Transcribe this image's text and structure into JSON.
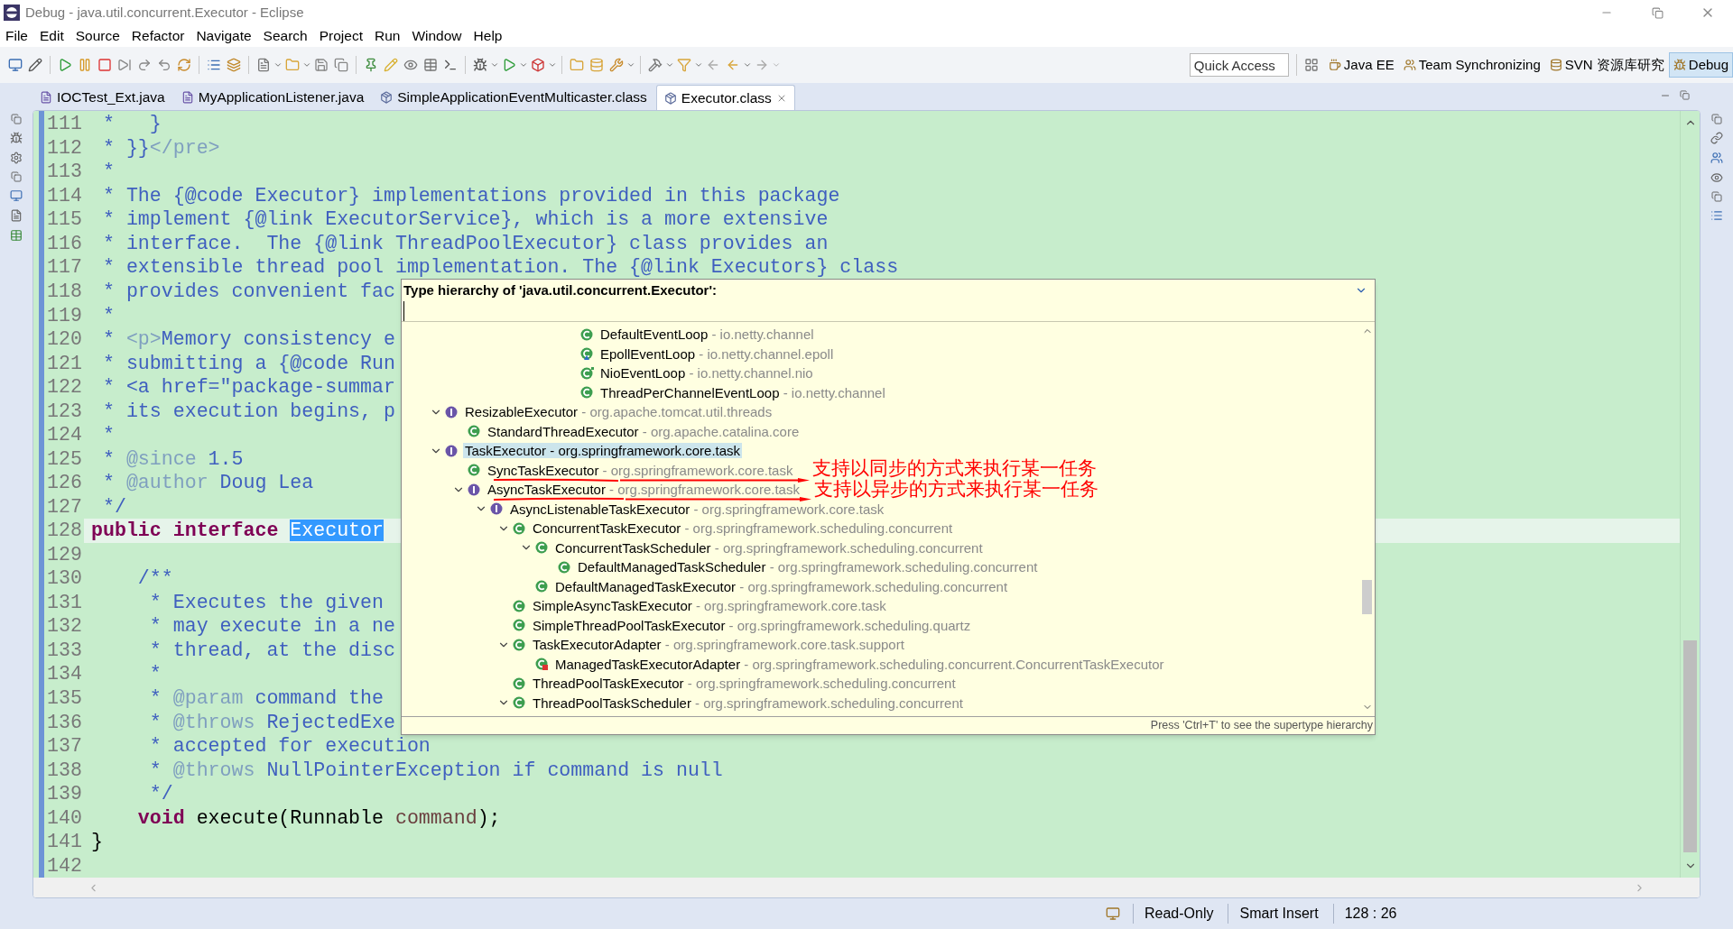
{
  "window": {
    "title": "Debug - java.util.concurrent.Executor - Eclipse"
  },
  "menu": [
    "File",
    "Edit",
    "Source",
    "Refactor",
    "Navigate",
    "Search",
    "Project",
    "Run",
    "Window",
    "Help"
  ],
  "quick_access": {
    "placeholder": "Quick Access"
  },
  "perspectives": [
    {
      "label": "Java EE",
      "selected": false
    },
    {
      "label": "Team Synchronizing",
      "selected": false
    },
    {
      "label": "SVN 资源库研究",
      "selected": false
    },
    {
      "label": "Debug",
      "selected": true
    }
  ],
  "editor_tabs": [
    {
      "label": "IOCTest_Ext.java",
      "kind": "java",
      "selected": false
    },
    {
      "label": "MyApplicationListener.java",
      "kind": "java",
      "selected": false
    },
    {
      "label": "SimpleApplicationEventMulticaster.class",
      "kind": "class",
      "selected": false
    },
    {
      "label": "Executor.class",
      "kind": "class",
      "selected": true
    }
  ],
  "code_lines": [
    {
      "number": "111",
      "current": false,
      "segments": [
        {
          "kind": "comment",
          "text": " *   }"
        }
      ]
    },
    {
      "number": "112",
      "current": false,
      "segments": [
        {
          "kind": "comment",
          "text": " * }}"
        },
        {
          "kind": "doc-tag",
          "text": "</pre>"
        }
      ]
    },
    {
      "number": "113",
      "current": false,
      "segments": [
        {
          "kind": "comment",
          "text": " *"
        }
      ]
    },
    {
      "number": "114",
      "current": false,
      "segments": [
        {
          "kind": "comment",
          "text": " * The {@code Executor} implementations provided in this package"
        }
      ]
    },
    {
      "number": "115",
      "current": false,
      "segments": [
        {
          "kind": "comment",
          "text": " * implement {@link ExecutorService}, which is a more extensive"
        }
      ]
    },
    {
      "number": "116",
      "current": false,
      "segments": [
        {
          "kind": "comment",
          "text": " * interface.  The {@link ThreadPoolExecutor} class provides an"
        }
      ]
    },
    {
      "number": "117",
      "current": false,
      "segments": [
        {
          "kind": "comment",
          "text": " * extensible thread pool implementation. The {@link Executors} class"
        }
      ]
    },
    {
      "number": "118",
      "current": false,
      "segments": [
        {
          "kind": "comment",
          "text": " * provides convenient fac"
        }
      ]
    },
    {
      "number": "119",
      "current": false,
      "segments": [
        {
          "kind": "comment",
          "text": " *"
        }
      ]
    },
    {
      "number": "120",
      "current": false,
      "segments": [
        {
          "kind": "comment",
          "text": " * "
        },
        {
          "kind": "doc-tag",
          "text": "<p>"
        },
        {
          "kind": "comment",
          "text": "Memory consistency e"
        }
      ]
    },
    {
      "number": "121",
      "current": false,
      "segments": [
        {
          "kind": "comment",
          "text": " * submitting a {@code Run"
        }
      ]
    },
    {
      "number": "122",
      "current": false,
      "segments": [
        {
          "kind": "comment",
          "text": " * <a href=\"package-summar"
        }
      ]
    },
    {
      "number": "123",
      "current": false,
      "segments": [
        {
          "kind": "comment",
          "text": " * its execution begins, p"
        }
      ]
    },
    {
      "number": "124",
      "current": false,
      "segments": [
        {
          "kind": "comment",
          "text": " *"
        }
      ]
    },
    {
      "number": "125",
      "current": false,
      "segments": [
        {
          "kind": "comment",
          "text": " * "
        },
        {
          "kind": "doc-tag",
          "text": "@since"
        },
        {
          "kind": "comment",
          "text": " 1.5"
        }
      ]
    },
    {
      "number": "126",
      "current": false,
      "segments": [
        {
          "kind": "comment",
          "text": " * "
        },
        {
          "kind": "doc-tag",
          "text": "@author"
        },
        {
          "kind": "comment",
          "text": " Doug Lea"
        }
      ]
    },
    {
      "number": "127",
      "current": false,
      "segments": [
        {
          "kind": "comment",
          "text": " */"
        }
      ]
    },
    {
      "number": "128",
      "current": true,
      "segments": [
        {
          "kind": "keyword",
          "text": "public interface "
        },
        {
          "kind": "selection",
          "text": "Executor"
        }
      ]
    },
    {
      "number": "129",
      "current": false
    },
    {
      "number": "130",
      "current": false,
      "segments": [
        {
          "kind": "comment",
          "text": "    /**"
        }
      ]
    },
    {
      "number": "131",
      "current": false,
      "segments": [
        {
          "kind": "comment",
          "text": "     * Executes the given"
        }
      ]
    },
    {
      "number": "132",
      "current": false,
      "segments": [
        {
          "kind": "comment",
          "text": "     * may execute in a ne"
        }
      ]
    },
    {
      "number": "133",
      "current": false,
      "segments": [
        {
          "kind": "comment",
          "text": "     * thread, at the disc"
        }
      ]
    },
    {
      "number": "134",
      "current": false,
      "segments": [
        {
          "kind": "comment",
          "text": "     *"
        }
      ]
    },
    {
      "number": "135",
      "current": false,
      "segments": [
        {
          "kind": "comment",
          "text": "     * "
        },
        {
          "kind": "doc-tag",
          "text": "@param"
        },
        {
          "kind": "comment",
          "text": " command the"
        }
      ]
    },
    {
      "number": "136",
      "current": false,
      "segments": [
        {
          "kind": "comment",
          "text": "     * "
        },
        {
          "kind": "doc-tag",
          "text": "@throws"
        },
        {
          "kind": "comment",
          "text": " RejectedExe"
        }
      ]
    },
    {
      "number": "137",
      "current": false,
      "segments": [
        {
          "kind": "comment",
          "text": "     * accepted for execution"
        }
      ]
    },
    {
      "number": "138",
      "current": false,
      "segments": [
        {
          "kind": "comment",
          "text": "     * "
        },
        {
          "kind": "doc-tag",
          "text": "@throws"
        },
        {
          "kind": "comment",
          "text": " NullPointerException if command is null"
        }
      ]
    },
    {
      "number": "139",
      "current": false,
      "segments": [
        {
          "kind": "comment",
          "text": "     */"
        }
      ]
    },
    {
      "number": "140",
      "current": false,
      "segments": [
        {
          "kind": "keyword",
          "text": "    void"
        },
        {
          "kind": "plain",
          "text": " execute(Runnable "
        },
        {
          "kind": "variable",
          "text": "command"
        },
        {
          "kind": "plain",
          "text": ");"
        }
      ]
    },
    {
      "number": "141",
      "current": false,
      "segments": [
        {
          "kind": "plain",
          "text": "}"
        }
      ]
    },
    {
      "number": "142",
      "current": false
    }
  ],
  "type_hierarchy": {
    "title": "Type hierarchy of 'java.util.concurrent.Executor':",
    "tree": [
      {
        "children": [
          {
            "children": [
              {
                "children": [
                  {
                    "children": [
                      {
                        "children": [
                          {
                            "children": [
                              {
                                "name": "DefaultEventLoop",
                                "detail": "- io.netty.channel",
                                "kind": "class",
                                "selected": false
                              },
                              {
                                "name": "EpollEventLoop",
                                "detail": "- io.netty.channel.epoll",
                                "kind": "final-default-class",
                                "selected": false
                              },
                              {
                                "name": "NioEventLoop",
                                "detail": "- io.netty.channel.nio",
                                "kind": "final-class",
                                "selected": false
                              },
                              {
                                "name": "ThreadPerChannelEventLoop",
                                "detail": "- io.netty.channel",
                                "kind": "class",
                                "selected": false
                              }
                            ]
                          }
                        ]
                      }
                    ]
                  }
                ]
              }
            ]
          }
        ]
      },
      {
        "name": "ResizableExecutor",
        "detail": "- org.apache.tomcat.util.threads",
        "kind": "interface",
        "expanded": true,
        "selected": false,
        "children": [
          {
            "name": "StandardThreadExecutor",
            "detail": "- org.apache.catalina.core",
            "kind": "class",
            "selected": false
          }
        ]
      },
      {
        "name": "TaskExecutor",
        "detail": "- org.springframework.core.task",
        "kind": "interface",
        "expanded": true,
        "selected": true,
        "children": [
          {
            "name": "SyncTaskExecutor",
            "detail": "- org.springframework.core.task",
            "kind": "class",
            "selected": false
          },
          {
            "name": "AsyncTaskExecutor",
            "detail": "- org.springframework.core.task",
            "kind": "interface",
            "expanded": true,
            "selected": false,
            "children": [
              {
                "name": "AsyncListenableTaskExecutor",
                "detail": "- org.springframework.core.task",
                "kind": "interface",
                "expanded": true,
                "selected": false,
                "children": [
                  {
                    "name": "ConcurrentTaskExecutor",
                    "detail": "- org.springframework.scheduling.concurrent",
                    "kind": "class",
                    "expanded": true,
                    "selected": false,
                    "children": [
                      {
                        "name": "ConcurrentTaskScheduler",
                        "detail": "- org.springframework.scheduling.concurrent",
                        "kind": "class",
                        "expanded": true,
                        "selected": false,
                        "children": [
                          {
                            "name": "DefaultManagedTaskScheduler",
                            "detail": "- org.springframework.scheduling.concurrent",
                            "kind": "class",
                            "selected": false
                          }
                        ]
                      },
                      {
                        "name": "DefaultManagedTaskExecutor",
                        "detail": "- org.springframework.scheduling.concurrent",
                        "kind": "class",
                        "selected": false
                      }
                    ]
                  },
                  {
                    "name": "SimpleAsyncTaskExecutor",
                    "detail": "- org.springframework.core.task",
                    "kind": "class",
                    "selected": false
                  },
                  {
                    "name": "SimpleThreadPoolTaskExecutor",
                    "detail": "- org.springframework.scheduling.quartz",
                    "kind": "class",
                    "selected": false
                  },
                  {
                    "name": "TaskExecutorAdapter",
                    "detail": "- org.springframework.core.task.support",
                    "kind": "class",
                    "expanded": true,
                    "selected": false,
                    "children": [
                      {
                        "name": "ManagedTaskExecutorAdapter",
                        "detail": "- org.springframework.scheduling.concurrent.ConcurrentTaskExecutor",
                        "kind": "private-static-class",
                        "selected": false
                      }
                    ]
                  },
                  {
                    "name": "ThreadPoolTaskExecutor",
                    "detail": "- org.springframework.scheduling.concurrent",
                    "kind": "class",
                    "selected": false
                  },
                  {
                    "name": "ThreadPoolTaskScheduler",
                    "detail": "- org.springframework.scheduling.concurrent",
                    "kind": "class",
                    "expanded": true,
                    "selected": false
                  }
                ]
              }
            ]
          }
        ]
      }
    ],
    "footer": "Press 'Ctrl+T' to see the supertype hierarchy"
  },
  "annotations": [
    {
      "text": "支持以同步的方式来执行某一任务"
    },
    {
      "text": "支持以异步的方式来执行某一任务"
    }
  ],
  "status_bar": [
    "Read-Only",
    "Smart Insert",
    "128 : 26"
  ]
}
